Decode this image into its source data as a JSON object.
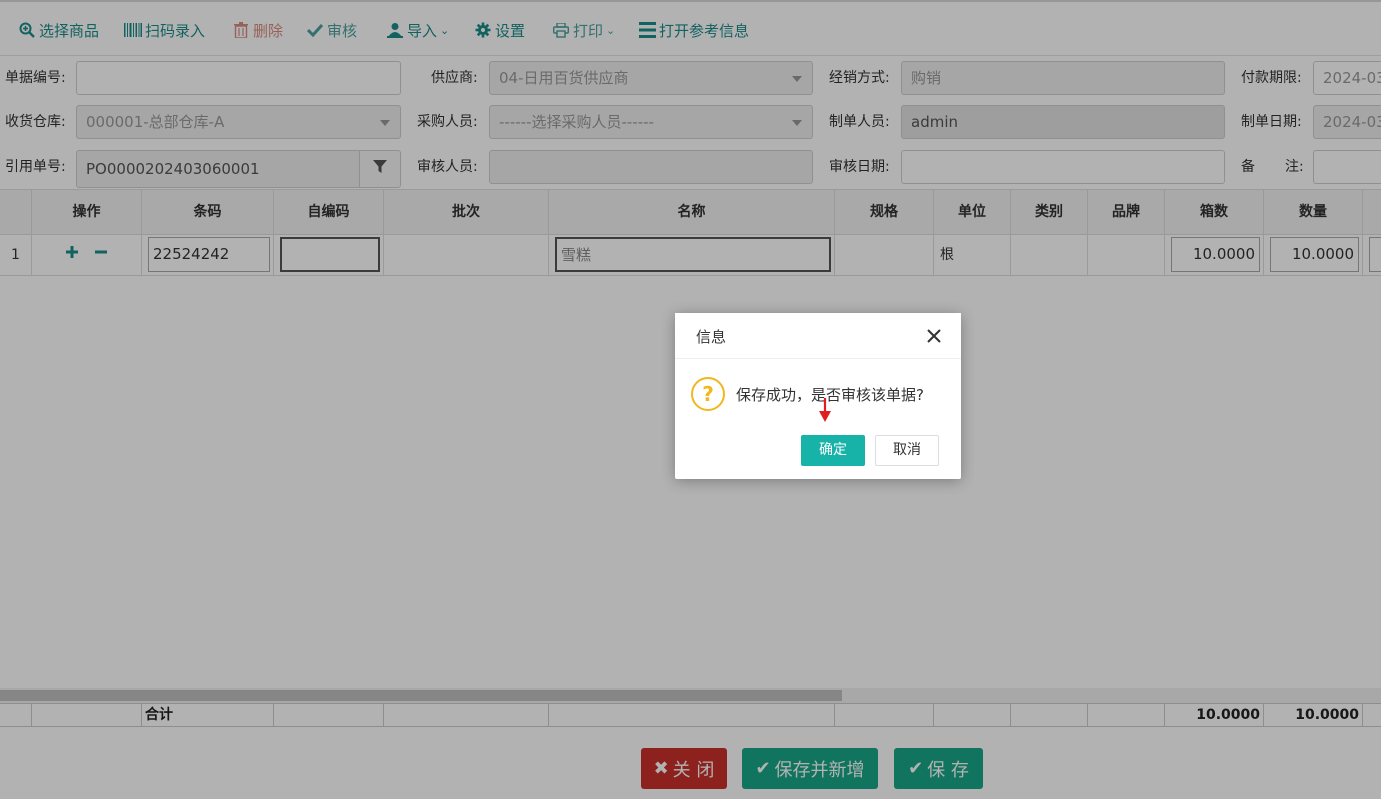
{
  "toolbar": {
    "select_goods": "选择商品",
    "scan_entry": "扫码录入",
    "delete": "删除",
    "audit": "审核",
    "import": "导入",
    "settings": "设置",
    "print": "打印",
    "reference_info": "打开参考信息"
  },
  "form": {
    "doc_no_label": "单据编号:",
    "doc_no_value": "",
    "supplier_label": "供应商:",
    "supplier_value": "04-日用百货供应商",
    "sales_mode_label": "经销方式:",
    "sales_mode_value": "购销",
    "pay_term_label": "付款期限:",
    "pay_term_value": "2024-03",
    "warehouse_label": "收货仓库:",
    "warehouse_value": "000001-总部仓库-A",
    "buyer_label": "采购人员:",
    "buyer_placeholder": "------选择采购人员------",
    "maker_label": "制单人员:",
    "maker_value": "admin",
    "make_date_label": "制单日期:",
    "make_date_value": "2024-03",
    "ref_no_label": "引用单号:",
    "ref_no_value": "PO0000202403060001",
    "auditor_label": "审核人员:",
    "auditor_value": "",
    "audit_date_label": "审核日期:",
    "audit_date_value": "",
    "remark_label_1": "备",
    "remark_label_2": "注:",
    "remark_value": ""
  },
  "grid": {
    "headers": [
      "操作",
      "条码",
      "自编码",
      "批次",
      "名称",
      "规格",
      "单位",
      "类别",
      "品牌",
      "箱数",
      "数量"
    ],
    "row": {
      "index": "1",
      "barcode": "22524242",
      "self_code": "",
      "batch": "",
      "name": "雪糕",
      "spec": "",
      "unit": "根",
      "category": "",
      "brand": "",
      "boxes": "10.0000",
      "qty": "10.0000"
    },
    "totals": {
      "label": "合计",
      "boxes": "10.0000",
      "qty": "10.0000"
    }
  },
  "footer": {
    "close": "关 闭",
    "save_and_new": "保存并新增",
    "save": "保 存"
  },
  "dialog": {
    "title": "信息",
    "message": "保存成功，是否审核该单据?",
    "ok": "确定",
    "cancel": "取消"
  },
  "colors": {
    "accent": "#18b3a8",
    "toolbar_text": "#1a8d8a",
    "danger": "#c9302c",
    "success": "#18a689"
  }
}
